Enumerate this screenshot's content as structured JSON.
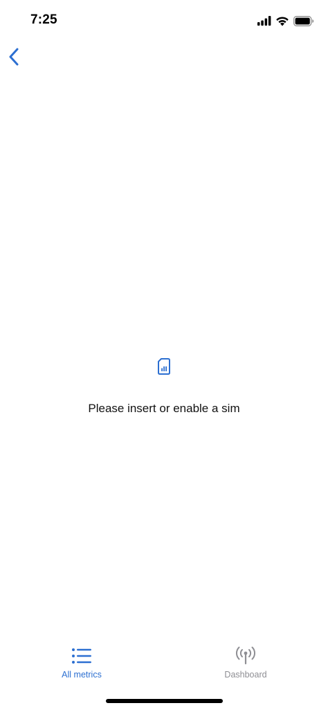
{
  "status_bar": {
    "time": "7:25",
    "icons": [
      "cellular-signal-icon",
      "wifi-icon",
      "battery-icon"
    ]
  },
  "nav": {
    "back_icon": "chevron-left-icon"
  },
  "empty_state": {
    "icon": "sim-card-icon",
    "message": "Please insert or enable a sim"
  },
  "tab_bar": {
    "tabs": [
      {
        "label": "All metrics",
        "icon": "list-icon",
        "active": true
      },
      {
        "label": "Dashboard",
        "icon": "antenna-icon",
        "active": false
      }
    ]
  },
  "colors": {
    "accent": "#2c6fd1",
    "inactive": "#8e8e93",
    "text": "#111111",
    "background": "#ffffff"
  }
}
